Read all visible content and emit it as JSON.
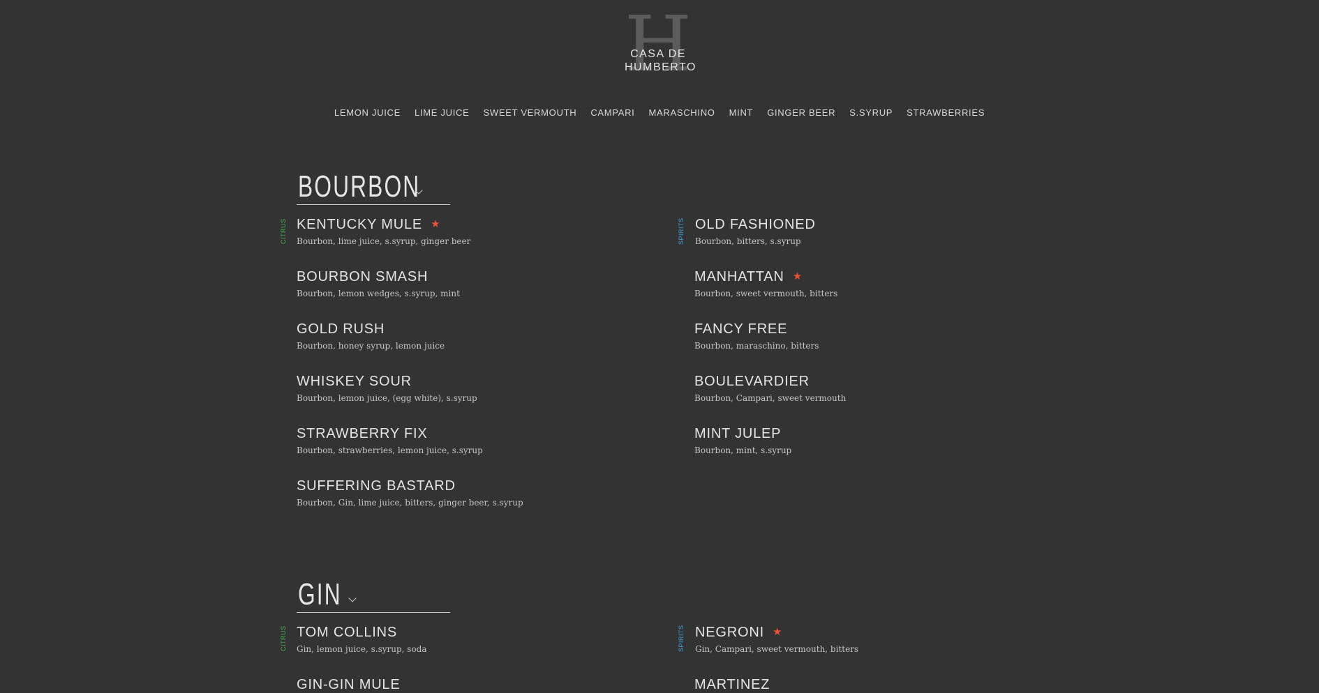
{
  "logo": {
    "letter": "H",
    "text": "CASA DE\nHUMBERTO"
  },
  "nav": {
    "items": [
      "LEMON JUICE",
      "LIME JUICE",
      "SWEET VERMOUTH",
      "CAMPARI",
      "MARASCHINO",
      "MINT",
      "GINGER BEER",
      "S.SYRUP",
      "STRAWBERRIES"
    ]
  },
  "tags": {
    "citrus": "CITRUS",
    "spirits": "SPIRITS"
  },
  "colors": {
    "background": "#333333",
    "star": "#e8533a",
    "citrus": "#44b652",
    "spirits": "#3e9fd8"
  },
  "sections": {
    "bourbon": {
      "title": "BOURBON",
      "left": [
        {
          "name": "KENTUCKY MULE",
          "desc": "Bourbon, lime juice, s.syrup, ginger beer",
          "starred": true
        },
        {
          "name": "BOURBON SMASH",
          "desc": "Bourbon, lemon wedges, s.syrup, mint",
          "starred": false
        },
        {
          "name": "GOLD RUSH",
          "desc": "Bourbon, honey syrup, lemon juice",
          "starred": false
        },
        {
          "name": "WHISKEY SOUR",
          "desc": "Bourbon, lemon juice, (egg white), s.syrup",
          "starred": false
        },
        {
          "name": "STRAWBERRY FIX",
          "desc": "Bourbon, strawberries, lemon juice, s.syrup",
          "starred": false
        },
        {
          "name": "SUFFERING BASTARD",
          "desc": "Bourbon, Gin, lime juice, bitters, ginger beer, s.syrup",
          "starred": false
        }
      ],
      "right": [
        {
          "name": "OLD FASHIONED",
          "desc": "Bourbon, bitters, s.syrup",
          "starred": false
        },
        {
          "name": "MANHATTAN",
          "desc": "Bourbon, sweet vermouth, bitters",
          "starred": true
        },
        {
          "name": "FANCY FREE",
          "desc": "Bourbon, maraschino, bitters",
          "starred": false
        },
        {
          "name": "BOULEVARDIER",
          "desc": "Bourbon, Campari, sweet vermouth",
          "starred": false
        },
        {
          "name": "MINT JULEP",
          "desc": "Bourbon, mint, s.syrup",
          "starred": false
        }
      ]
    },
    "gin": {
      "title": "GIN",
      "left": [
        {
          "name": "TOM COLLINS",
          "desc": "Gin, lemon juice, s.syrup, soda",
          "starred": false
        },
        {
          "name": "GIN-GIN MULE",
          "desc": "",
          "starred": false
        }
      ],
      "right": [
        {
          "name": "NEGRONI",
          "desc": "Gin, Campari, sweet vermouth, bitters",
          "starred": true
        },
        {
          "name": "MARTINEZ",
          "desc": "",
          "starred": false
        }
      ]
    }
  }
}
